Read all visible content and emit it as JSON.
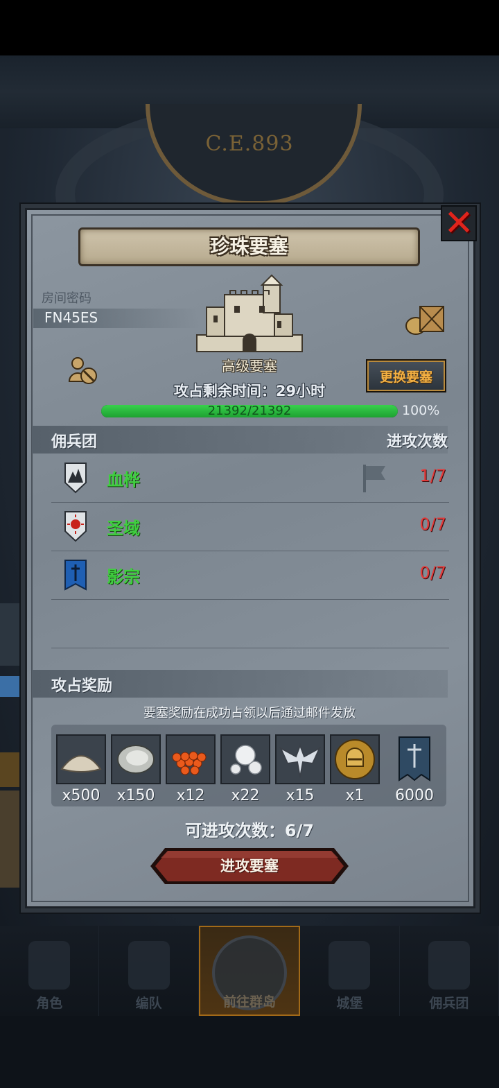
{
  "background": {
    "era_text": "C.E.893"
  },
  "dialog": {
    "title": "珍珠要塞",
    "close_icon": "close-icon",
    "room_code_label": "房间密码",
    "room_code": "FN45ES",
    "fortress_type": "高级要塞",
    "change_button": "更换要塞",
    "timer_text": "攻占剩余时间：29小时",
    "hp_text": "21392/21392",
    "hp_fraction": 1.0,
    "hp_percent": "100%",
    "guild_section": {
      "left_label": "佣兵团",
      "right_label": "进攻次数",
      "guilds": [
        {
          "name": "血桦",
          "count": "1/7",
          "emblem": "mountain-shield-icon",
          "flag": true
        },
        {
          "name": "圣域",
          "count": "0/7",
          "emblem": "sun-shield-icon",
          "flag": false
        },
        {
          "name": "影宗",
          "count": "0/7",
          "emblem": "sword-banner-icon",
          "flag": false
        }
      ]
    },
    "reward_section": {
      "label": "攻占奖励",
      "note": "要塞奖励在成功占领以后通过邮件发放",
      "items": [
        {
          "icon": "sand-pile-icon",
          "qty": "x500"
        },
        {
          "icon": "oyster-icon",
          "qty": "x150"
        },
        {
          "icon": "fish-roe-icon",
          "qty": "x12"
        },
        {
          "icon": "pearl-icon",
          "qty": "x22"
        },
        {
          "icon": "wing-emblem-icon",
          "qty": "x15"
        },
        {
          "icon": "knight-helmet-medal-icon",
          "qty": "x1"
        },
        {
          "icon": "guild-banner-icon",
          "qty": "6000"
        }
      ]
    },
    "attacks_remaining": "可进攻次数：6/7",
    "attack_button": "进攻要塞"
  },
  "bottom_nav": {
    "items": [
      {
        "label": "角色",
        "icon": "knight-icon",
        "active": false
      },
      {
        "label": "编队",
        "icon": "helmet-icon",
        "active": false
      },
      {
        "label": "前往群岛",
        "icon": "island-compass-icon",
        "active": true
      },
      {
        "label": "城堡",
        "icon": "castle-icon",
        "active": false
      },
      {
        "label": "佣兵团",
        "icon": "flag-knight-icon",
        "active": false
      }
    ]
  },
  "colors": {
    "guild_name": "#3fcf3f",
    "attack_count": "#e33a3a",
    "hp_bar": "#2fbf44",
    "close_x": "#e0241c",
    "change_button_text": "#f3b043",
    "attack_button": "#7e2a22"
  }
}
